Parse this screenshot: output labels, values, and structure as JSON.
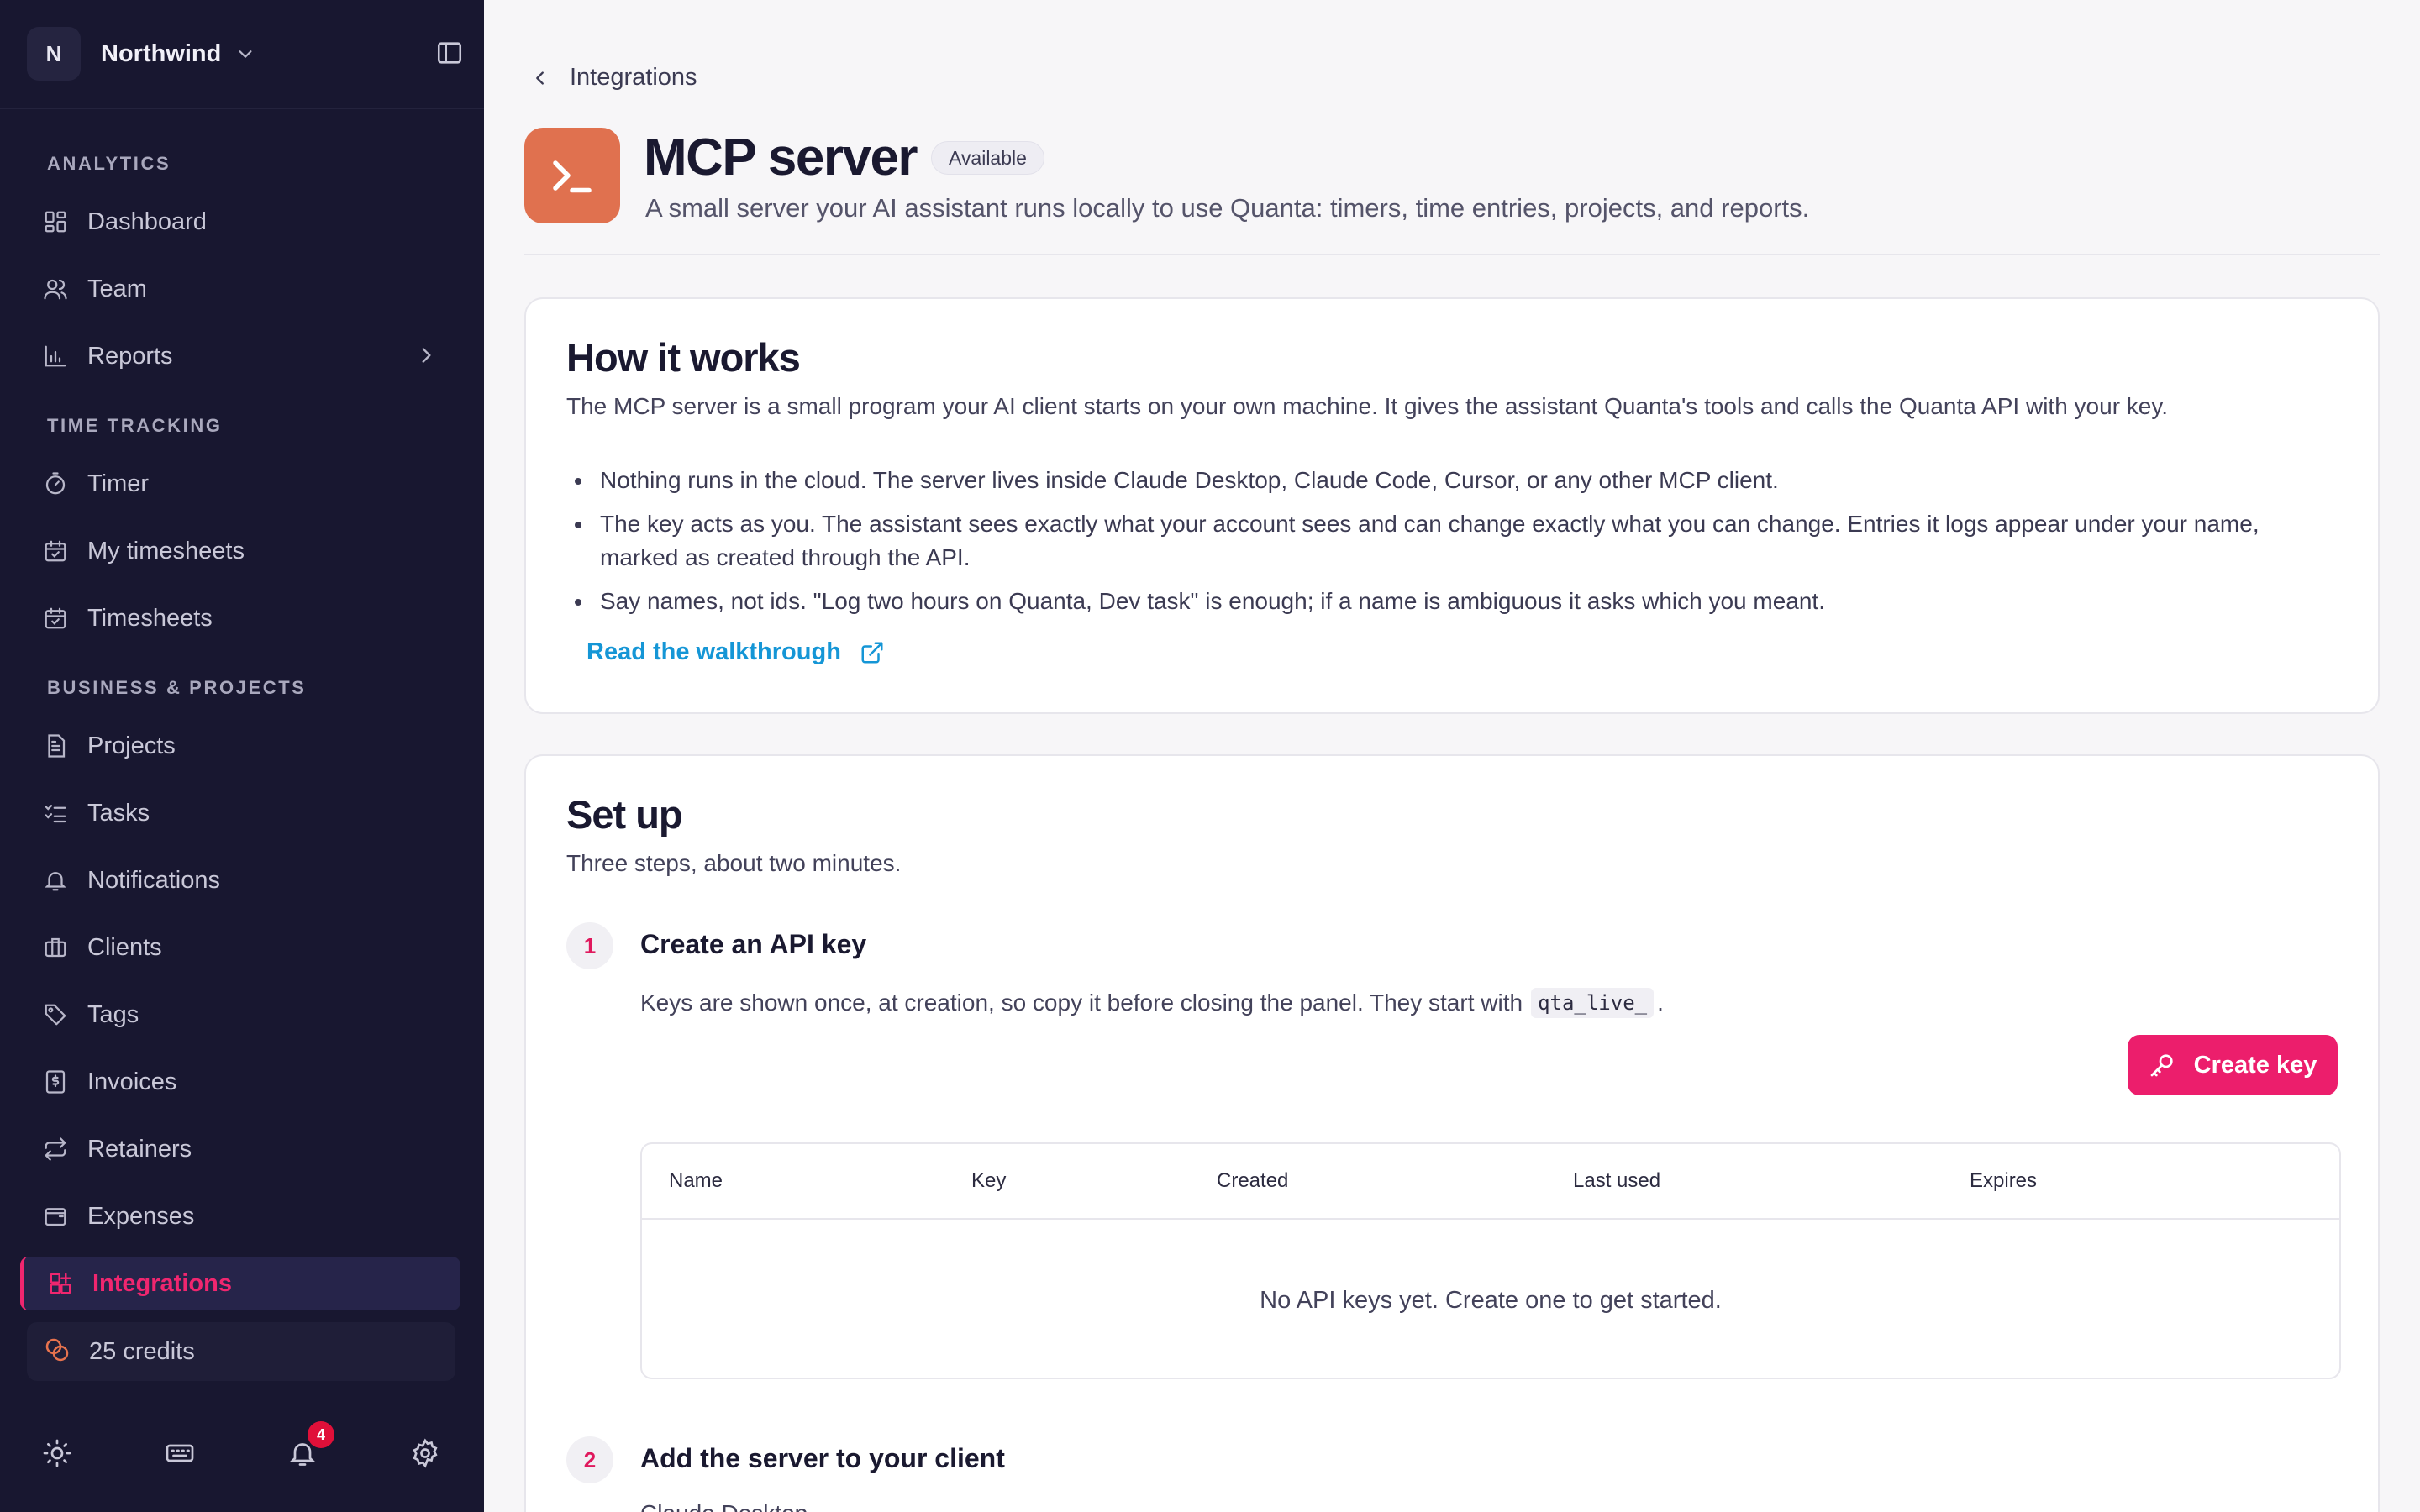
{
  "sidebar": {
    "org": {
      "initial": "N",
      "name": "Northwind"
    },
    "sections": {
      "analytics": "ANALYTICS",
      "time_tracking": "TIME TRACKING",
      "business": "BUSINESS & PROJECTS"
    },
    "items": {
      "dashboard": "Dashboard",
      "team": "Team",
      "reports": "Reports",
      "timer": "Timer",
      "my_timesheets": "My timesheets",
      "timesheets": "Timesheets",
      "projects": "Projects",
      "tasks": "Tasks",
      "notifications": "Notifications",
      "clients": "Clients",
      "tags": "Tags",
      "invoices": "Invoices",
      "retainers": "Retainers",
      "expenses": "Expenses",
      "integrations": "Integrations"
    },
    "credits": "25 credits",
    "notification_count": "4",
    "accent_color": "#f0266f"
  },
  "header": {
    "breadcrumb": "Integrations",
    "title": "MCP server",
    "status": "Available",
    "subtitle": "A small server your AI assistant runs locally to use Quanta: timers, time entries, projects, and reports."
  },
  "how_it_works": {
    "title": "How it works",
    "lead": "The MCP server is a small program your AI client starts on your own machine. It gives the assistant Quanta's tools and calls the Quanta API with your key.",
    "bullets": [
      "Nothing runs in the cloud. The server lives inside Claude Desktop, Claude Code, Cursor, or any other MCP client.",
      "The key acts as you. The assistant sees exactly what your account sees and can change exactly what you can change. Entries it logs appear under your name, marked as created through the API.",
      "Say names, not ids. \"Log two hours on Quanta, Dev task\" is enough; if a name is ambiguous it asks which you meant."
    ],
    "link": "Read the walkthrough"
  },
  "setup": {
    "title": "Set up",
    "lead": "Three steps, about two minutes.",
    "step1": {
      "number": "1",
      "title": "Create an API key",
      "desc_before": "Keys are shown once, at creation, so copy it before closing the panel. They start with",
      "code": "qta_live_",
      "desc_after": ".",
      "button": "Create key",
      "table": {
        "columns": [
          "Name",
          "Key",
          "Created",
          "Last used",
          "Expires"
        ],
        "empty": "No API keys yet. Create one to get started."
      }
    },
    "step2": {
      "number": "2",
      "title": "Add the server to your client",
      "partial": "Claude Desktop"
    }
  }
}
